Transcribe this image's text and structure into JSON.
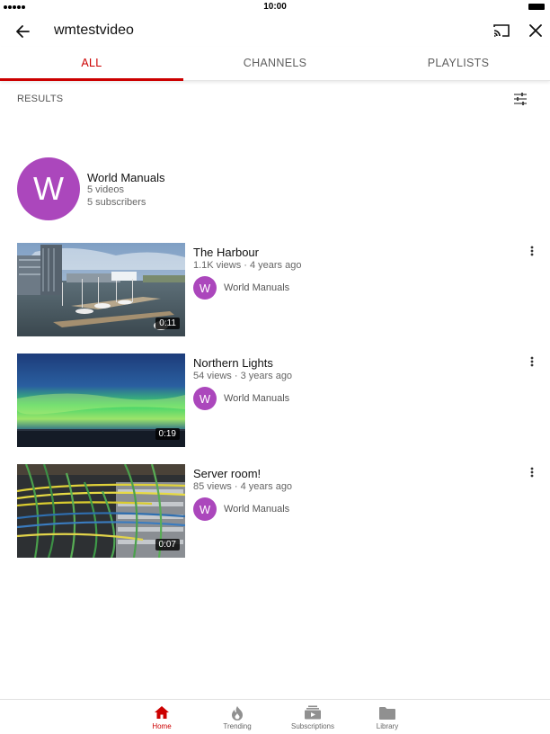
{
  "status_bar": {
    "time": "10:00"
  },
  "header": {
    "search_query": "wmtestvideo"
  },
  "tabs": [
    {
      "label": "ALL",
      "active": true
    },
    {
      "label": "CHANNELS",
      "active": false
    },
    {
      "label": "PLAYLISTS",
      "active": false
    }
  ],
  "results": {
    "label": "RESULTS",
    "channel": {
      "avatar_letter": "W",
      "name": "World Manuals",
      "videos": "5 videos",
      "subscribers": "5 subscribers"
    },
    "videos": [
      {
        "title": "The Harbour",
        "meta": "1.1K views · 4 years ago",
        "duration": "0:11",
        "uploader": "World Manuals",
        "avatar_letter": "W"
      },
      {
        "title": "Northern Lights",
        "meta": "54 views · 3 years ago",
        "duration": "0:19",
        "uploader": "World Manuals",
        "avatar_letter": "W"
      },
      {
        "title": "Server room!",
        "meta": "85 views · 4 years ago",
        "duration": "0:07",
        "uploader": "World Manuals",
        "avatar_letter": "W"
      }
    ]
  },
  "bottom_nav": [
    {
      "label": "Home",
      "icon": "home-icon",
      "active": true
    },
    {
      "label": "Trending",
      "icon": "flame-icon",
      "active": false
    },
    {
      "label": "Subscriptions",
      "icon": "subscriptions-icon",
      "active": false
    },
    {
      "label": "Library",
      "icon": "folder-icon",
      "active": false
    }
  ],
  "colors": {
    "accent": "#cc0000",
    "avatar": "#ab47bc",
    "nav_inactive": "#909090"
  }
}
